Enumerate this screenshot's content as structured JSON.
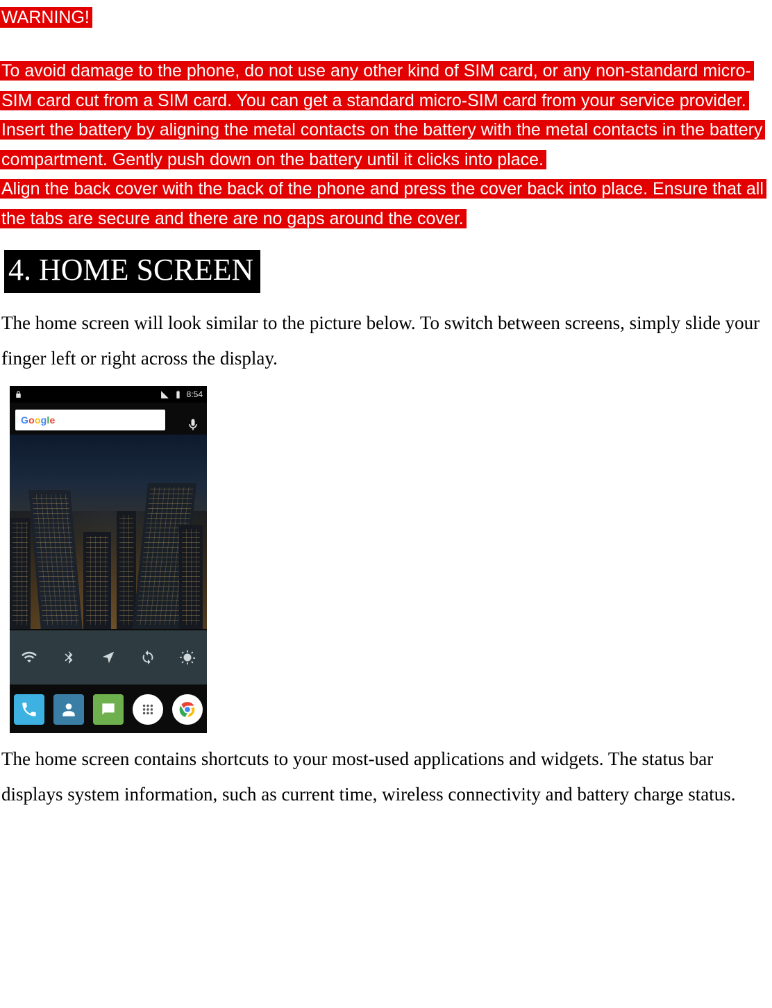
{
  "warning": {
    "title": "WARNING!",
    "p1": "To avoid damage to the phone, do not use any other kind of SIM card, or any non-standard micro-SIM card cut from a SIM card. You can get a standard micro-SIM card from your service provider.",
    "p2": "Insert the battery by aligning the metal contacts on the battery with the metal contacts in the battery compartment. Gently push down on the battery until it clicks into place.",
    "p3": "Align the back cover with the back of the phone and press the cover back into place. Ensure that all the tabs are secure and there are no gaps around the cover."
  },
  "section": {
    "heading": "4. HOME SCREEN"
  },
  "body": {
    "para1": "The home screen will look similar to the picture below. To switch between screens, simply slide your finger left or right across the display.",
    "para2": "The home screen contains shortcuts to your most-used applications and widgets. The status bar displays system information, such as current time, wireless connectivity and battery charge status."
  },
  "phone": {
    "status": {
      "time": "8:54"
    },
    "search": {
      "logo": "Google"
    },
    "toggles": [
      "wifi",
      "bluetooth",
      "location",
      "refresh",
      "brightness"
    ],
    "dock": [
      "phone",
      "contacts",
      "messages",
      "apps",
      "chrome"
    ]
  },
  "icons": {
    "lock": "lock-icon",
    "signal": "signal-icon",
    "battery": "battery-icon",
    "mic": "mic-icon"
  }
}
